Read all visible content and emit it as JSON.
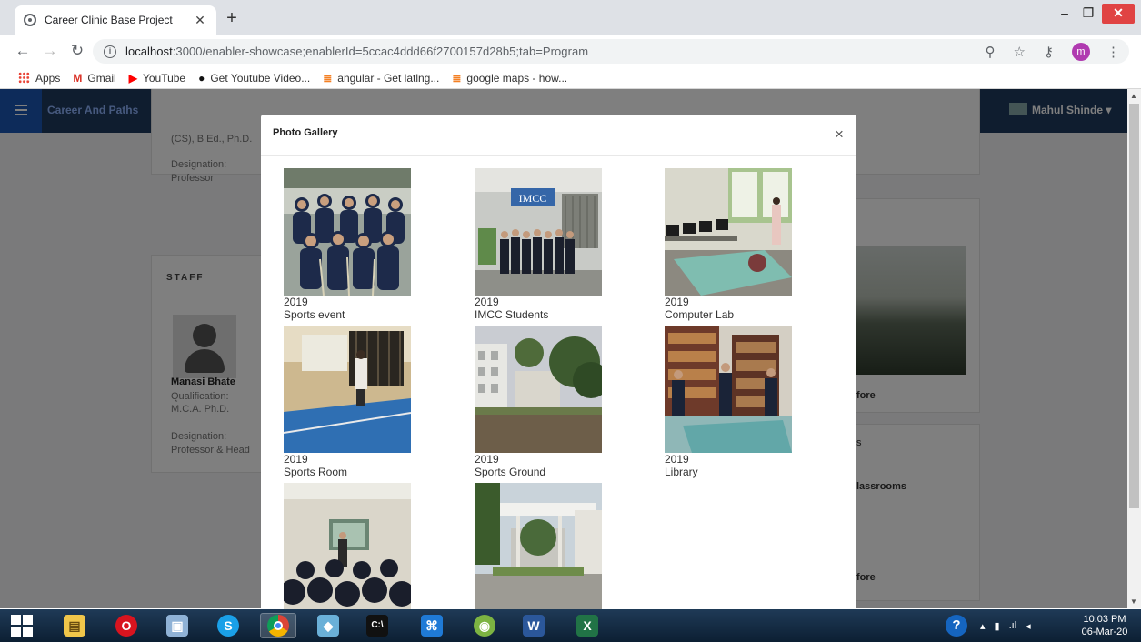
{
  "browser": {
    "tab_title": "Career Clinic Base Project",
    "url_host": "localhost",
    "url_rest": ":3000/enabler-showcase;enablerId=5ccac4ddd66f2700157d28b5;tab=Program",
    "bookmarks": [
      {
        "label": "Apps",
        "icon": "apps-grid-icon",
        "color": "#e94235"
      },
      {
        "label": "Gmail",
        "icon": "gmail-icon",
        "color": "#d93025"
      },
      {
        "label": "YouTube",
        "icon": "youtube-icon",
        "color": "#ff0000"
      },
      {
        "label": "Get Youtube Video...",
        "icon": "github-icon",
        "color": "#111111"
      },
      {
        "label": "angular - Get latlng...",
        "icon": "stackoverflow-icon",
        "color": "#f48024"
      },
      {
        "label": "google maps - how...",
        "icon": "stackoverflow-icon",
        "color": "#f48024"
      }
    ],
    "profile_initial": "m"
  },
  "app": {
    "brand": "Career And Paths",
    "user_name": "Mahul Shinde",
    "bg": {
      "qual_1": "(CS), B.Ed., Ph.D.",
      "designation_label": "Designation:",
      "designation_1": "Professor",
      "staff_heading": "STAFF",
      "staff_name": "Manasi Bhate",
      "qualification_label": "Qualification:",
      "qualification_2": "M.C.A. Ph.D.",
      "designation_2": "Professor & Head",
      "more_1": "fore",
      "classrooms": "lassrooms",
      "more_2": "fore",
      "s_letter": "s"
    }
  },
  "modal": {
    "title": "Photo Gallery",
    "close": "×",
    "items": [
      {
        "year": "2019",
        "caption": "Sports event"
      },
      {
        "year": "2019",
        "caption": "IMCC Students"
      },
      {
        "year": "2019",
        "caption": "Computer Lab"
      },
      {
        "year": "2019",
        "caption": "Sports Room"
      },
      {
        "year": "2019",
        "caption": "Sports Ground"
      },
      {
        "year": "2019",
        "caption": "Library"
      },
      {
        "year": "",
        "caption": ""
      },
      {
        "year": "",
        "caption": ""
      }
    ],
    "sign_text": "IMCC"
  },
  "taskbar": {
    "time": "10:03 PM",
    "date": "06-Mar-20"
  }
}
